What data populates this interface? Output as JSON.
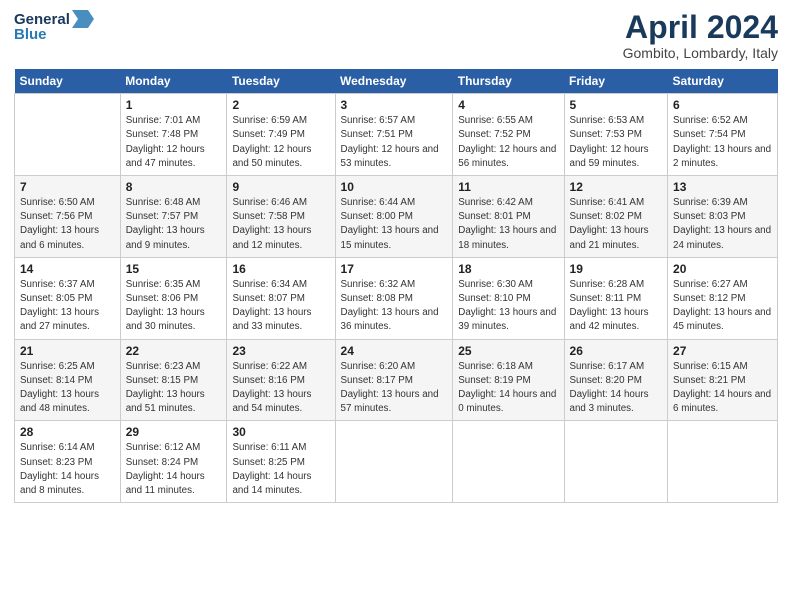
{
  "logo": {
    "line1": "General",
    "line2": "Blue"
  },
  "title": "April 2024",
  "subtitle": "Gombito, Lombardy, Italy",
  "weekdays": [
    "Sunday",
    "Monday",
    "Tuesday",
    "Wednesday",
    "Thursday",
    "Friday",
    "Saturday"
  ],
  "weeks": [
    [
      null,
      {
        "day": 1,
        "sunrise": "7:01 AM",
        "sunset": "7:48 PM",
        "daylight": "12 hours and 47 minutes."
      },
      {
        "day": 2,
        "sunrise": "6:59 AM",
        "sunset": "7:49 PM",
        "daylight": "12 hours and 50 minutes."
      },
      {
        "day": 3,
        "sunrise": "6:57 AM",
        "sunset": "7:51 PM",
        "daylight": "12 hours and 53 minutes."
      },
      {
        "day": 4,
        "sunrise": "6:55 AM",
        "sunset": "7:52 PM",
        "daylight": "12 hours and 56 minutes."
      },
      {
        "day": 5,
        "sunrise": "6:53 AM",
        "sunset": "7:53 PM",
        "daylight": "12 hours and 59 minutes."
      },
      {
        "day": 6,
        "sunrise": "6:52 AM",
        "sunset": "7:54 PM",
        "daylight": "13 hours and 2 minutes."
      }
    ],
    [
      {
        "day": 7,
        "sunrise": "6:50 AM",
        "sunset": "7:56 PM",
        "daylight": "13 hours and 6 minutes."
      },
      {
        "day": 8,
        "sunrise": "6:48 AM",
        "sunset": "7:57 PM",
        "daylight": "13 hours and 9 minutes."
      },
      {
        "day": 9,
        "sunrise": "6:46 AM",
        "sunset": "7:58 PM",
        "daylight": "13 hours and 12 minutes."
      },
      {
        "day": 10,
        "sunrise": "6:44 AM",
        "sunset": "8:00 PM",
        "daylight": "13 hours and 15 minutes."
      },
      {
        "day": 11,
        "sunrise": "6:42 AM",
        "sunset": "8:01 PM",
        "daylight": "13 hours and 18 minutes."
      },
      {
        "day": 12,
        "sunrise": "6:41 AM",
        "sunset": "8:02 PM",
        "daylight": "13 hours and 21 minutes."
      },
      {
        "day": 13,
        "sunrise": "6:39 AM",
        "sunset": "8:03 PM",
        "daylight": "13 hours and 24 minutes."
      }
    ],
    [
      {
        "day": 14,
        "sunrise": "6:37 AM",
        "sunset": "8:05 PM",
        "daylight": "13 hours and 27 minutes."
      },
      {
        "day": 15,
        "sunrise": "6:35 AM",
        "sunset": "8:06 PM",
        "daylight": "13 hours and 30 minutes."
      },
      {
        "day": 16,
        "sunrise": "6:34 AM",
        "sunset": "8:07 PM",
        "daylight": "13 hours and 33 minutes."
      },
      {
        "day": 17,
        "sunrise": "6:32 AM",
        "sunset": "8:08 PM",
        "daylight": "13 hours and 36 minutes."
      },
      {
        "day": 18,
        "sunrise": "6:30 AM",
        "sunset": "8:10 PM",
        "daylight": "13 hours and 39 minutes."
      },
      {
        "day": 19,
        "sunrise": "6:28 AM",
        "sunset": "8:11 PM",
        "daylight": "13 hours and 42 minutes."
      },
      {
        "day": 20,
        "sunrise": "6:27 AM",
        "sunset": "8:12 PM",
        "daylight": "13 hours and 45 minutes."
      }
    ],
    [
      {
        "day": 21,
        "sunrise": "6:25 AM",
        "sunset": "8:14 PM",
        "daylight": "13 hours and 48 minutes."
      },
      {
        "day": 22,
        "sunrise": "6:23 AM",
        "sunset": "8:15 PM",
        "daylight": "13 hours and 51 minutes."
      },
      {
        "day": 23,
        "sunrise": "6:22 AM",
        "sunset": "8:16 PM",
        "daylight": "13 hours and 54 minutes."
      },
      {
        "day": 24,
        "sunrise": "6:20 AM",
        "sunset": "8:17 PM",
        "daylight": "13 hours and 57 minutes."
      },
      {
        "day": 25,
        "sunrise": "6:18 AM",
        "sunset": "8:19 PM",
        "daylight": "14 hours and 0 minutes."
      },
      {
        "day": 26,
        "sunrise": "6:17 AM",
        "sunset": "8:20 PM",
        "daylight": "14 hours and 3 minutes."
      },
      {
        "day": 27,
        "sunrise": "6:15 AM",
        "sunset": "8:21 PM",
        "daylight": "14 hours and 6 minutes."
      }
    ],
    [
      {
        "day": 28,
        "sunrise": "6:14 AM",
        "sunset": "8:23 PM",
        "daylight": "14 hours and 8 minutes."
      },
      {
        "day": 29,
        "sunrise": "6:12 AM",
        "sunset": "8:24 PM",
        "daylight": "14 hours and 11 minutes."
      },
      {
        "day": 30,
        "sunrise": "6:11 AM",
        "sunset": "8:25 PM",
        "daylight": "14 hours and 14 minutes."
      },
      null,
      null,
      null,
      null
    ]
  ]
}
